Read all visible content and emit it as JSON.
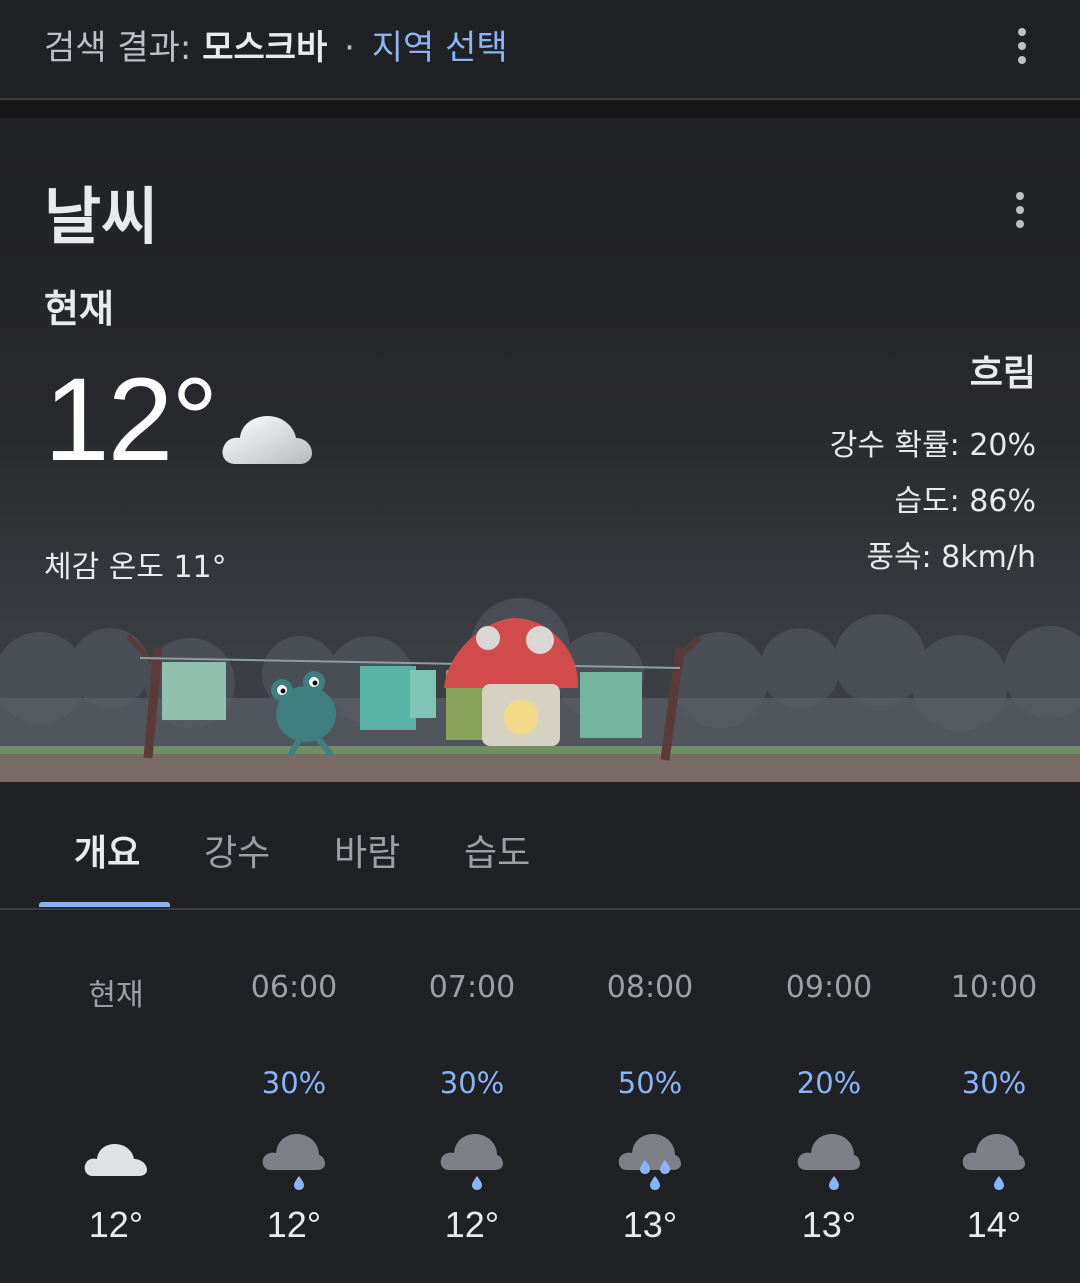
{
  "header": {
    "prefix": "검색 결과:",
    "location": "모스크바",
    "separator": "·",
    "select_region": "지역 선택"
  },
  "weather": {
    "heading": "날씨",
    "now_label": "현재",
    "temperature": "12°",
    "icon": "cloudy-icon",
    "feels_like": "체감 온도 11°",
    "condition": "흐림",
    "precip_prob": "강수 확률: 20%",
    "humidity": "습도: 86%",
    "wind": "풍속: 8km/h"
  },
  "tabs": [
    "개요",
    "강수",
    "바람",
    "습도"
  ],
  "active_tab": "개요",
  "hourly": [
    {
      "time": "현재",
      "precip": "",
      "icon": "cloudy-icon",
      "temp": "12°"
    },
    {
      "time": "06:00",
      "precip": "30%",
      "icon": "light-rain-icon",
      "temp": "12°"
    },
    {
      "time": "07:00",
      "precip": "30%",
      "icon": "light-rain-icon",
      "temp": "12°"
    },
    {
      "time": "08:00",
      "precip": "50%",
      "icon": "rain-icon",
      "temp": "13°"
    },
    {
      "time": "09:00",
      "precip": "20%",
      "icon": "light-rain-icon",
      "temp": "13°"
    },
    {
      "time": "10:00",
      "precip": "30%",
      "icon": "light-rain-icon",
      "temp": "14°"
    }
  ],
  "colors": {
    "background": "#202124",
    "accent": "#8ab4f8",
    "text": "#e8eaed",
    "muted": "#9aa0a6"
  }
}
